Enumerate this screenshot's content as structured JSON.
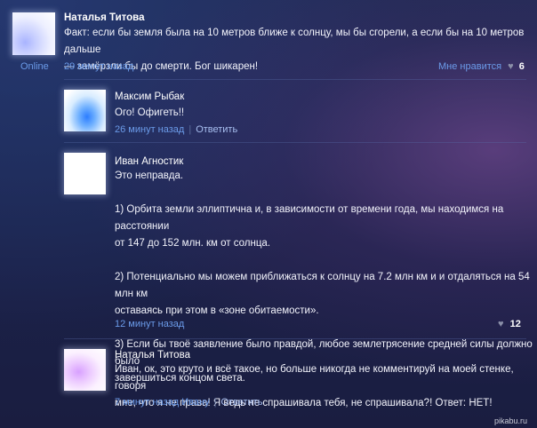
{
  "main_post": {
    "author": "Наталья Титова",
    "text_lines": [
      "Факт: если бы земля была на 10 метров ближе к солнцу, мы бы сгорели, а если бы на 10 метров дальше",
      "— замёрзли бы до смерти. Бог шикарен!"
    ],
    "status": "Online",
    "time": "29 минут назад",
    "like_label": "Мне нравится",
    "like_count": "6"
  },
  "comments": [
    {
      "author": "Максим Рыбак",
      "text_lines": [
        "Ого! Офигеть!!"
      ],
      "time": "26 минут назад",
      "reply_label": "Ответить"
    },
    {
      "author": "Иван Агностик",
      "text_lines": [
        "Это неправда.",
        "",
        "1) Орбита земли эллиптична и, в зависимости от времени года, мы находимся на расстоянии",
        "от 147 до 152 млн. км от солнца.",
        "",
        "2) Потенциально мы можем приближаться к солнцу на 7.2 млн км и и отдаляться на 54 млн км",
        "оставаясь при этом в «зоне обитаемости».",
        "",
        "3) Если бы твоё заявление было правдой, любое землетрясение средней силы должно было",
        "завершиться концом света."
      ],
      "time": "12 минут назад",
      "like_count": "12"
    },
    {
      "author": "Наталья Титова",
      "text_lines": [
        "Иван, ок, это круто и всё такое, но больше никогда не комментируй на моей стенке, говоря",
        "мне, что я не права! Я ведь не спрашивала тебя, не спрашивала?! Ответ: НЕТ!"
      ],
      "time": "7 минут назад Ивану",
      "reply_label": "Ответить"
    }
  ],
  "watermark": "pikabu.ru",
  "icons": {
    "like": "heart-icon"
  }
}
